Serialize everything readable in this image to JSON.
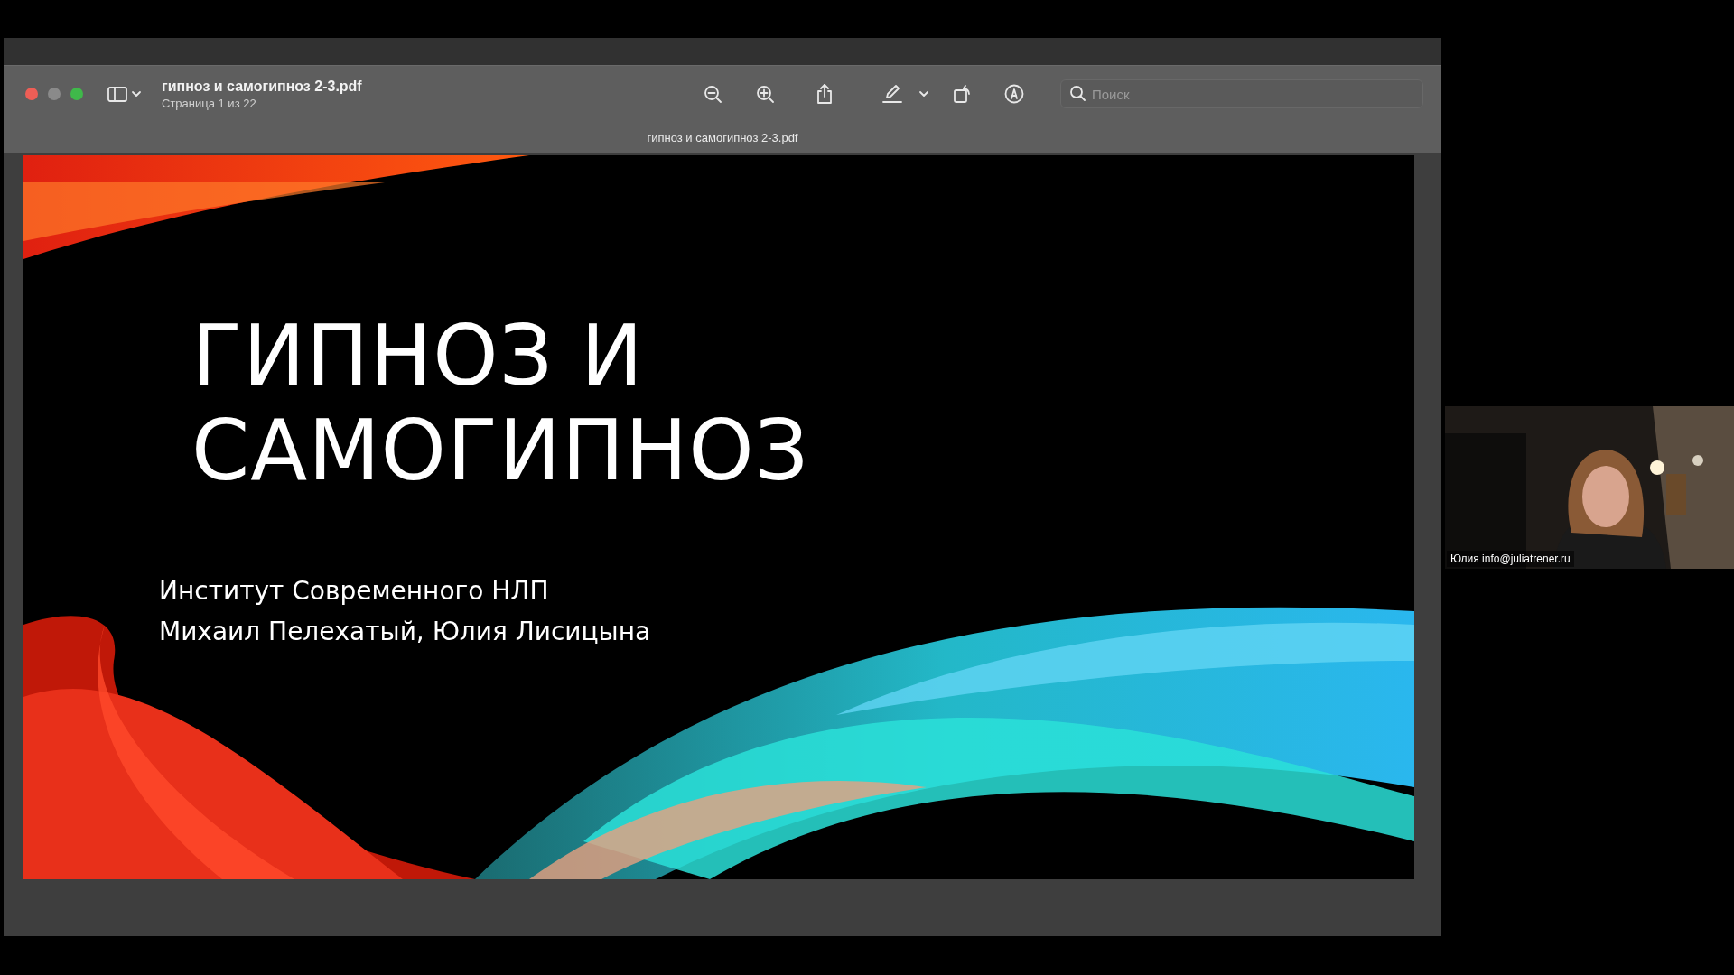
{
  "window": {
    "title": "гипноз и самогипноз 2-3.pdf",
    "subtitle": "Страница 1 из 22",
    "document_title": "гипноз и самогипноз 2-3.pdf"
  },
  "search": {
    "placeholder": "Поиск"
  },
  "slide": {
    "title_lines": [
      "ГИПНОЗ И",
      "САМОГИПНОЗ"
    ],
    "subtitle_lines": [
      "Институт Современного НЛП",
      "Михаил Пелехатый, Юлия Лисицына"
    ]
  },
  "video": {
    "kind": "picture",
    "label": "Юлия info@juliatrener.ru"
  }
}
